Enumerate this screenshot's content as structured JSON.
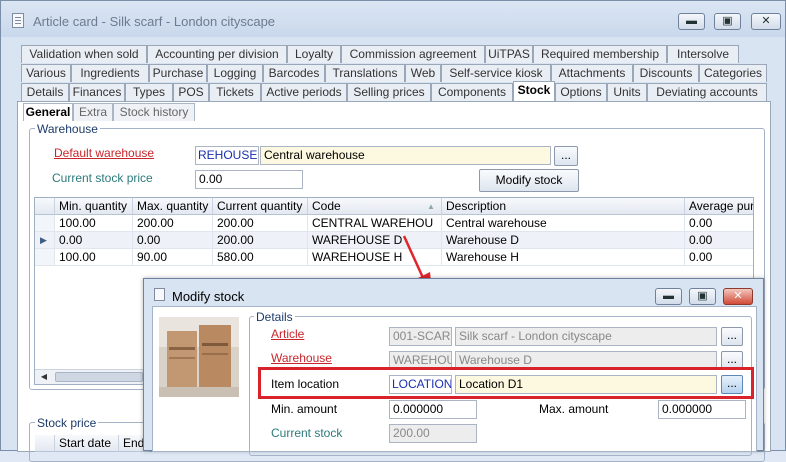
{
  "window": {
    "title": "Article card - Silk scarf - London cityscape",
    "min_label": "▬",
    "max_label": "▣",
    "close_label": "✕"
  },
  "tabs_row1": [
    "Validation when sold",
    "Accounting per division",
    "Loyalty",
    "Commission agreement",
    "UiTPAS",
    "Required membership",
    "Intersolve"
  ],
  "tabs_row2": [
    "Various",
    "Ingredients",
    "Purchase",
    "Logging",
    "Barcodes",
    "Translations",
    "Web",
    "Self-service kiosk",
    "Attachments",
    "Discounts",
    "Categories"
  ],
  "tabs_row3": [
    "Details",
    "Finances",
    "Types",
    "POS",
    "Tickets",
    "Active periods",
    "Selling prices",
    "Components",
    "Stock",
    "Options",
    "Units",
    "Deviating accounts"
  ],
  "subtabs": [
    "General",
    "Extra",
    "Stock history"
  ],
  "warehouse": {
    "group_label": "Warehouse",
    "default_warehouse_label": "Default warehouse",
    "default_warehouse_code": "REHOUSE",
    "default_warehouse_name": "Central warehouse",
    "browse_label": "...",
    "stock_price_label": "Current stock price",
    "stock_price_value": "0.00",
    "modify_stock_button": "Modify stock"
  },
  "grid": {
    "columns": [
      "Min. quantity",
      "Max. quantity",
      "Current quantity",
      "Code",
      "Description",
      "Average purch"
    ],
    "rows": [
      [
        "100.00",
        "200.00",
        "200.00",
        "CENTRAL WAREHOU",
        "Central warehouse",
        "0.00"
      ],
      [
        "0.00",
        "0.00",
        "200.00",
        "WAREHOUSE D",
        "Warehouse D",
        "0.00"
      ],
      [
        "100.00",
        "90.00",
        "580.00",
        "WAREHOUSE H",
        "Warehouse H",
        "0.00"
      ]
    ],
    "selected_row_marker": "▶",
    "scroll_left": "◀"
  },
  "stock_price": {
    "group_label": "Stock price",
    "columns": [
      "Start date",
      "End"
    ]
  },
  "dialog": {
    "title": "Modify stock",
    "details_label": "Details",
    "article_label": "Article",
    "article_code": "001-SCAR",
    "article_name": "Silk scarf - London cityscape",
    "warehouse_label": "Warehouse",
    "warehouse_code": "WAREHOU",
    "warehouse_name": "Warehouse D",
    "location_label": "Item location",
    "location_code": "LOCATION",
    "location_name": "Location D1",
    "browse_label": "...",
    "min_label": "Min. amount",
    "min_value": "0.000000",
    "max_label": "Max. amount",
    "max_value": "0.000000",
    "current_label": "Current stock",
    "current_value": "200.00"
  },
  "colors": {
    "required_label": "#c8262b",
    "highlight_box": "#d9222a",
    "code_text": "#1a2fb0",
    "field_yellow": "#fdf8e0"
  }
}
